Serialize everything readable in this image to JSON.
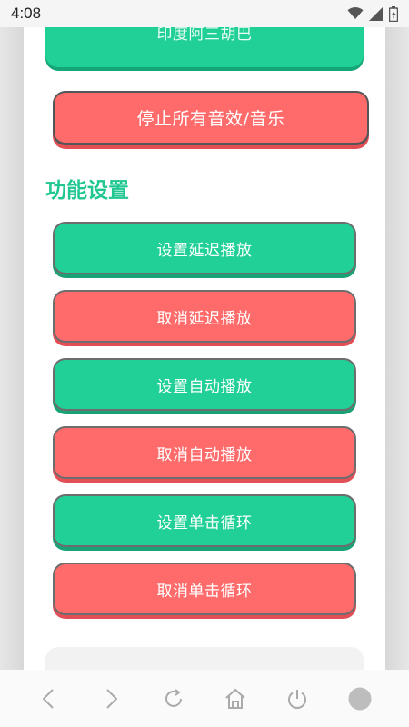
{
  "status_bar": {
    "time": "4:08",
    "icons": [
      "wifi-icon",
      "signal-icon",
      "battery-icon"
    ]
  },
  "top_button": {
    "label": "印度阿三胡巴"
  },
  "stop_button": {
    "label": "停止所有音效/音乐"
  },
  "section": {
    "title": "功能设置"
  },
  "feature_buttons": [
    {
      "label": "设置延迟播放",
      "color": "#21d096"
    },
    {
      "label": "取消延迟播放",
      "color": "#ff6b6b"
    },
    {
      "label": "设置自动播放",
      "color": "#21d096"
    },
    {
      "label": "取消自动播放",
      "color": "#ff6b6b"
    },
    {
      "label": "设置单击循环",
      "color": "#21d096"
    },
    {
      "label": "取消单击循环",
      "color": "#ff6b6b"
    }
  ],
  "nav_bar": {
    "items": [
      "back-icon",
      "forward-icon",
      "reload-icon",
      "home-icon",
      "power-icon",
      "menu-circle-icon"
    ]
  },
  "colors": {
    "accent_green": "#21d096",
    "accent_red": "#ff6b6b",
    "title_green": "#21c791"
  }
}
